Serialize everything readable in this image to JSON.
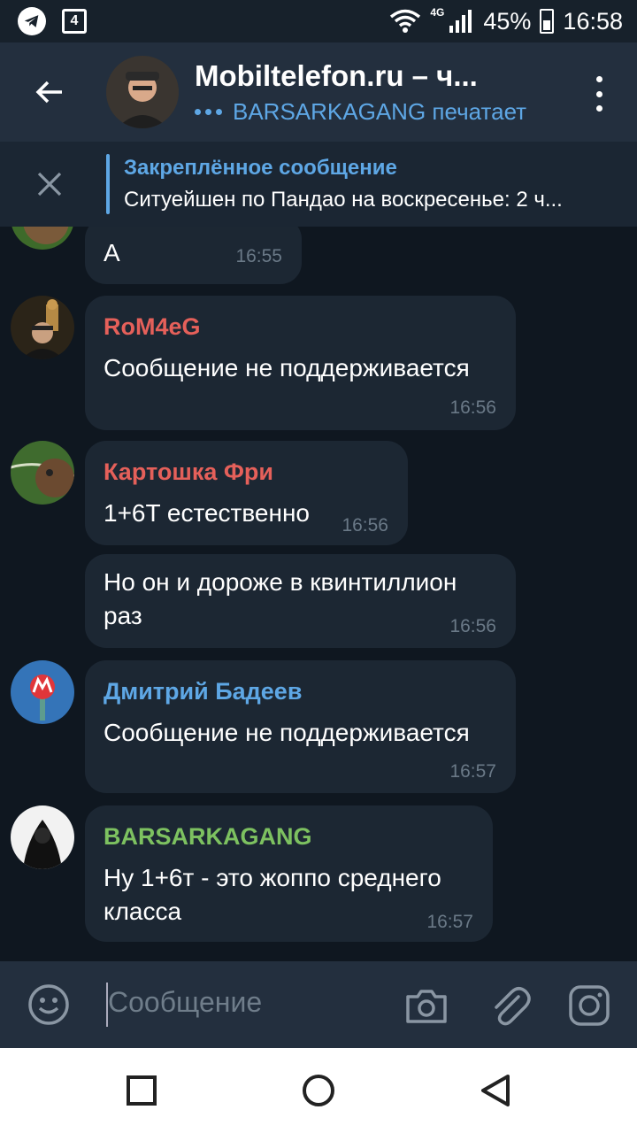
{
  "status_bar": {
    "network": "4G",
    "battery": "45%",
    "time": "16:58",
    "notification_badge": "4"
  },
  "header": {
    "title": "Mobiltelefon.ru – ч...",
    "status": "BARSARKAGANG печатает"
  },
  "pinned": {
    "title": "Закреплённое сообщение",
    "text": "Ситуейшен по Пандао на воскресенье: 2 ч..."
  },
  "messages": [
    {
      "text": "А",
      "time": "16:55"
    },
    {
      "sender": "RoM4eG",
      "sender_color": "#e5605a",
      "text": "Сообщение не поддерживается",
      "time": "16:56"
    },
    {
      "sender": "Картошка Фри",
      "sender_color": "#e5605a",
      "text": "1+6T естественно",
      "time": "16:56"
    },
    {
      "text_line1": "Но он и дороже в квинтиллион",
      "text_line2": "раз",
      "time": "16:56"
    },
    {
      "sender": "Дмитрий Бадеев",
      "sender_color": "#5ea7e5",
      "text": "Сообщение не поддерживается",
      "time": "16:57"
    },
    {
      "sender": "BARSARKAGANG",
      "sender_color": "#7dc160",
      "text_line1": "Ну 1+6т - это жоппо среднего",
      "text_line2": "класса",
      "time": "16:57"
    }
  ],
  "input": {
    "placeholder": "Сообщение"
  },
  "icons": {
    "back": "arrow-left-icon",
    "menu": "more-vert-icon",
    "close": "close-icon",
    "emoji": "emoji-icon",
    "camera": "camera-icon",
    "attach": "paperclip-icon",
    "instagram": "instagram-icon"
  },
  "colors": {
    "accent": "#5ea7e5",
    "background": "#0f1720",
    "bubble": "#1c2733",
    "header": "#232f3e"
  }
}
